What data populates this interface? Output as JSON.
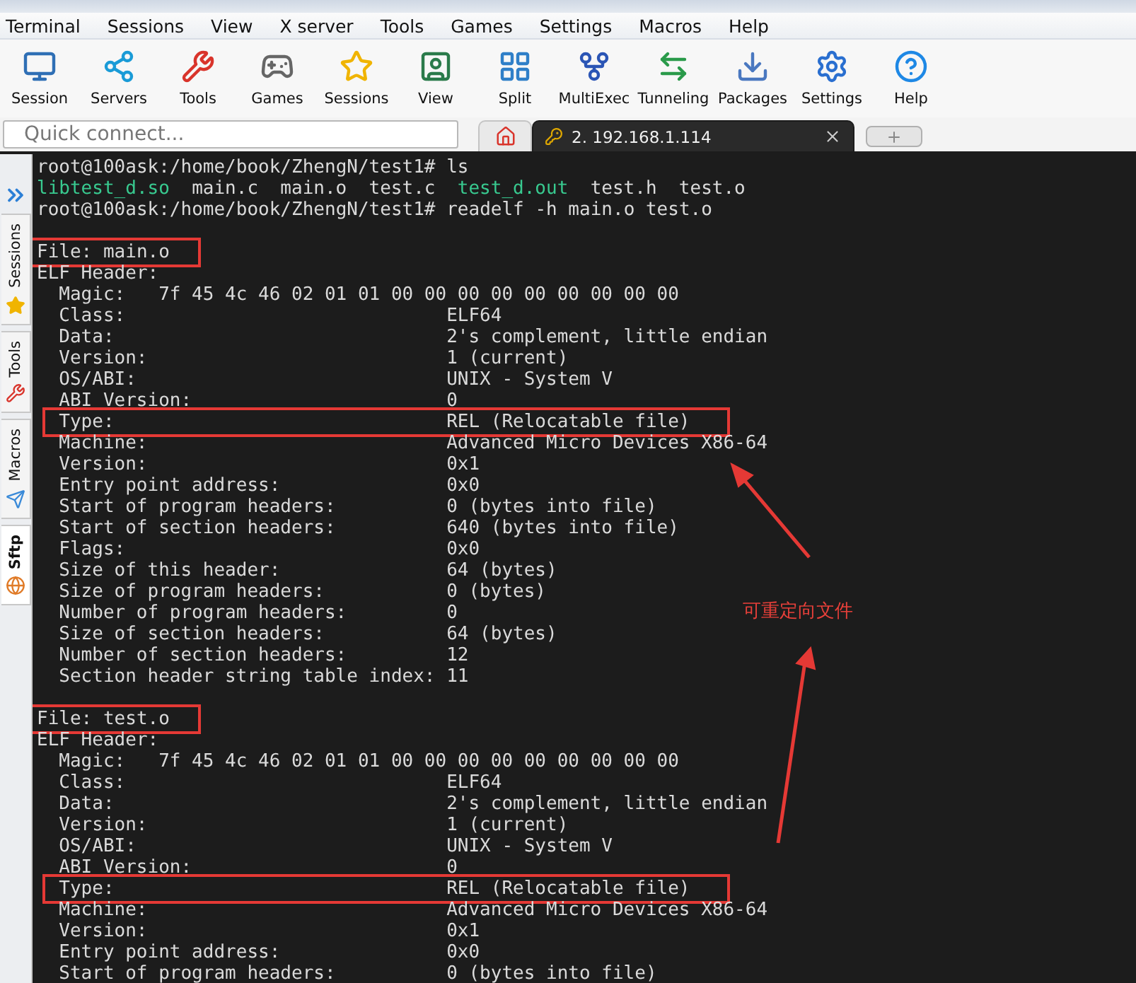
{
  "menu": [
    "Terminal",
    "Sessions",
    "View",
    "X server",
    "Tools",
    "Games",
    "Settings",
    "Macros",
    "Help"
  ],
  "toolbar": [
    {
      "label": "Session"
    },
    {
      "label": "Servers"
    },
    {
      "label": "Tools"
    },
    {
      "label": "Games"
    },
    {
      "label": "Sessions"
    },
    {
      "label": "View"
    },
    {
      "label": "Split"
    },
    {
      "label": "MultiExec"
    },
    {
      "label": "Tunneling"
    },
    {
      "label": "Packages"
    },
    {
      "label": "Settings"
    },
    {
      "label": "Help"
    }
  ],
  "quick_connect": {
    "placeholder": "Quick connect..."
  },
  "tabs": [
    {
      "kind": "home",
      "selected": false
    },
    {
      "kind": "session",
      "label": "2. 192.168.1.114",
      "selected": true
    }
  ],
  "side_tabs": [
    {
      "label": "Sessions",
      "selected": false
    },
    {
      "label": "Tools",
      "selected": false
    },
    {
      "label": "Macros",
      "selected": false
    },
    {
      "label": "Sftp",
      "selected": true
    }
  ],
  "terminal": {
    "lines": [
      {
        "kind": "text",
        "text": "root@100ask:/home/book/ZhengN/test1# ls",
        "highlight": false
      },
      {
        "kind": "listing",
        "files": [
          {
            "name": "libtest_d.so",
            "executable": true
          },
          {
            "name": "main.c",
            "executable": false
          },
          {
            "name": "main.o",
            "executable": false
          },
          {
            "name": "test.c",
            "executable": false
          },
          {
            "name": "test_d.out",
            "executable": true
          },
          {
            "name": "test.h",
            "executable": false
          },
          {
            "name": "test.o",
            "executable": false
          }
        ],
        "highlight": false
      },
      {
        "kind": "text",
        "text": "root@100ask:/home/book/ZhengN/test1# readelf -h main.o test.o",
        "highlight": false
      },
      {
        "kind": "blank",
        "highlight": false
      },
      {
        "kind": "text",
        "text": "File: main.o",
        "highlight": true
      },
      {
        "kind": "text",
        "text": "ELF Header:",
        "highlight": false
      },
      {
        "kind": "magic",
        "label": "Magic:",
        "value": "7f 45 4c 46 02 01 01 00 00 00 00 00 00 00 00 00",
        "highlight": false
      },
      {
        "kind": "field",
        "label": "Class:",
        "value": "ELF64",
        "highlight": false
      },
      {
        "kind": "field",
        "label": "Data:",
        "value": "2's complement, little endian",
        "highlight": false
      },
      {
        "kind": "field",
        "label": "Version:",
        "value": "1 (current)",
        "highlight": false
      },
      {
        "kind": "field",
        "label": "OS/ABI:",
        "value": "UNIX - System V",
        "highlight": false
      },
      {
        "kind": "field",
        "label": "ABI Version:",
        "value": "0",
        "highlight": false
      },
      {
        "kind": "field",
        "label": "Type:",
        "value": "REL (Relocatable file)",
        "highlight": true
      },
      {
        "kind": "field",
        "label": "Machine:",
        "value": "Advanced Micro Devices X86-64",
        "highlight": false
      },
      {
        "kind": "field",
        "label": "Version:",
        "value": "0x1",
        "highlight": false
      },
      {
        "kind": "field",
        "label": "Entry point address:",
        "value": "0x0",
        "highlight": false
      },
      {
        "kind": "field",
        "label": "Start of program headers:",
        "value": "0 (bytes into file)",
        "highlight": false
      },
      {
        "kind": "field",
        "label": "Start of section headers:",
        "value": "640 (bytes into file)",
        "highlight": false
      },
      {
        "kind": "field",
        "label": "Flags:",
        "value": "0x0",
        "highlight": false
      },
      {
        "kind": "field",
        "label": "Size of this header:",
        "value": "64 (bytes)",
        "highlight": false
      },
      {
        "kind": "field",
        "label": "Size of program headers:",
        "value": "0 (bytes)",
        "highlight": false
      },
      {
        "kind": "field",
        "label": "Number of program headers:",
        "value": "0",
        "highlight": false
      },
      {
        "kind": "field",
        "label": "Size of section headers:",
        "value": "64 (bytes)",
        "highlight": false
      },
      {
        "kind": "field",
        "label": "Number of section headers:",
        "value": "12",
        "highlight": false
      },
      {
        "kind": "field",
        "label": "Section header string table index:",
        "value": "11",
        "highlight": false
      },
      {
        "kind": "blank",
        "highlight": false
      },
      {
        "kind": "text",
        "text": "File: test.o",
        "highlight": true
      },
      {
        "kind": "text",
        "text": "ELF Header:",
        "highlight": false
      },
      {
        "kind": "magic",
        "label": "Magic:",
        "value": "7f 45 4c 46 02 01 01 00 00 00 00 00 00 00 00 00",
        "highlight": false
      },
      {
        "kind": "field",
        "label": "Class:",
        "value": "ELF64",
        "highlight": false
      },
      {
        "kind": "field",
        "label": "Data:",
        "value": "2's complement, little endian",
        "highlight": false
      },
      {
        "kind": "field",
        "label": "Version:",
        "value": "1 (current)",
        "highlight": false
      },
      {
        "kind": "field",
        "label": "OS/ABI:",
        "value": "UNIX - System V",
        "highlight": false
      },
      {
        "kind": "field",
        "label": "ABI Version:",
        "value": "0",
        "highlight": false
      },
      {
        "kind": "field",
        "label": "Type:",
        "value": "REL (Relocatable file)",
        "highlight": true
      },
      {
        "kind": "field",
        "label": "Machine:",
        "value": "Advanced Micro Devices X86-64",
        "highlight": false
      },
      {
        "kind": "field",
        "label": "Version:",
        "value": "0x1",
        "highlight": false
      },
      {
        "kind": "field",
        "label": "Entry point address:",
        "value": "0x0",
        "highlight": false
      },
      {
        "kind": "field",
        "label": "Start of program headers:",
        "value": "0 (bytes into file)",
        "highlight": false
      }
    ]
  },
  "annotation": {
    "text": "可重定向文件"
  }
}
